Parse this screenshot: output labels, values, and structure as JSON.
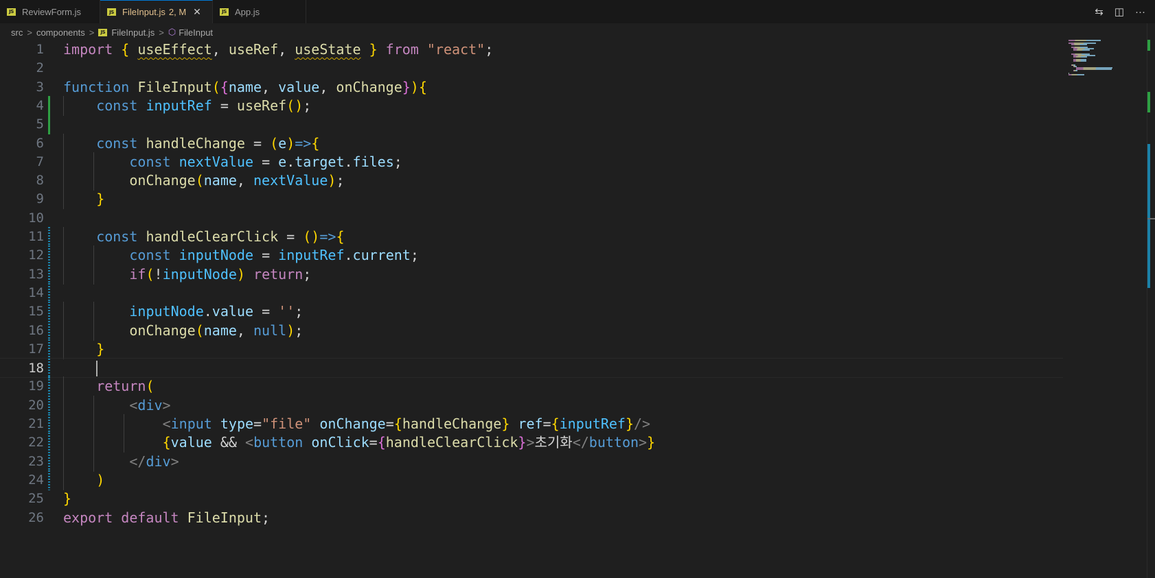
{
  "tabs": [
    {
      "label": "ReviewForm.js",
      "icon": "js-file-icon",
      "active": false,
      "status": ""
    },
    {
      "label": "FileInput.js",
      "icon": "js-file-icon",
      "active": true,
      "status": "2, M"
    },
    {
      "label": "App.js",
      "icon": "js-file-icon",
      "active": false,
      "status": ""
    }
  ],
  "tab_actions": {
    "compare_icon": "git-compare-icon",
    "split_icon": "split-editor-icon",
    "more_icon": "more-actions-icon",
    "compare_glyph": "⇆",
    "split_glyph": "◫",
    "more_glyph": "···"
  },
  "breadcrumb": {
    "segments": [
      "src",
      "components",
      "FileInput.js",
      "FileInput"
    ],
    "separator": ">"
  },
  "editor": {
    "current_line": 18,
    "colors": {
      "background": "#1f1f1f",
      "keyword": "#c586c0",
      "storage": "#569cd6",
      "function": "#dcdcaa",
      "variable": "#9cdcfe",
      "string": "#ce9178",
      "bracket_gold": "#ffd700",
      "bracket_orchid": "#da70d6",
      "bracket_blue": "#179fff",
      "git_added": "#2ea043",
      "git_modified": "#1b81a8"
    },
    "lines": [
      {
        "n": "1",
        "code": "import { useEffect, useRef, useState } from \"react\";"
      },
      {
        "n": "2",
        "code": ""
      },
      {
        "n": "3",
        "code": "function FileInput({name, value, onChange}){"
      },
      {
        "n": "4",
        "code": "    const inputRef = useRef();"
      },
      {
        "n": "5",
        "code": ""
      },
      {
        "n": "6",
        "code": "    const handleChange = (e)=>{"
      },
      {
        "n": "7",
        "code": "        const nextValue = e.target.files;"
      },
      {
        "n": "8",
        "code": "        onChange(name, nextValue);"
      },
      {
        "n": "9",
        "code": "    }"
      },
      {
        "n": "10",
        "code": ""
      },
      {
        "n": "11",
        "code": "    const handleClearClick = ()=>{"
      },
      {
        "n": "12",
        "code": "        const inputNode = inputRef.current;"
      },
      {
        "n": "13",
        "code": "        if(!inputNode) return;"
      },
      {
        "n": "14",
        "code": ""
      },
      {
        "n": "15",
        "code": "        inputNode.value = '';"
      },
      {
        "n": "16",
        "code": "        onChange(name, null);"
      },
      {
        "n": "17",
        "code": "    }"
      },
      {
        "n": "18",
        "code": ""
      },
      {
        "n": "19",
        "code": "    return("
      },
      {
        "n": "20",
        "code": "        <div>"
      },
      {
        "n": "21",
        "code": "            <input type=\"file\" onChange={handleChange} ref={inputRef}/>"
      },
      {
        "n": "22",
        "code": "            {value && <button onClick={handleClearClick}>초기화</button>}"
      },
      {
        "n": "23",
        "code": "        </div>"
      },
      {
        "n": "24",
        "code": "    )"
      },
      {
        "n": "25",
        "code": "}"
      },
      {
        "n": "26",
        "code": "export default FileInput;"
      }
    ]
  }
}
